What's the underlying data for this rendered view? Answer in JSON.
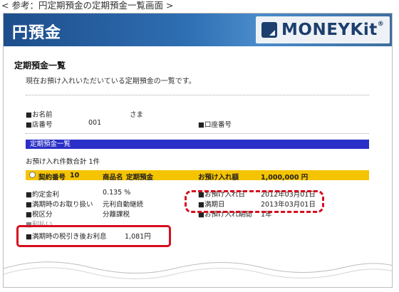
{
  "caption": "< 参考：円定期預金の定期預金一覧画面 >",
  "header": {
    "title": "円預金",
    "logo_text": "MONEYKit",
    "logo_tm": "®"
  },
  "page": {
    "title": "定期預金一覧",
    "description": "現在お預け入れいただいている定期預金の一覧です。"
  },
  "customer": {
    "name_label": "■お名前",
    "name_suffix": "さま",
    "branch_label": "■店番号",
    "branch_value": "001",
    "account_label": "■口座番号"
  },
  "section": {
    "title": "定期預金一覧",
    "count_label": "お預け入れ件数合計",
    "count_value": "1件"
  },
  "deposit_row": {
    "contract_label": "契約番号",
    "contract_value": "10",
    "product_label": "商品名",
    "product_value": "定期預金",
    "amount_label": "お預け入れ額",
    "amount_value": "1,000,000 円"
  },
  "details": {
    "rate_label": "■約定金利",
    "rate_value": "0.135 %",
    "maturity_handling_label": "■満期時のお取り扱い",
    "maturity_handling_value": "元利自動継続",
    "tax_label": "■税区分",
    "tax_value": "分離課税",
    "interest_label": "■利払い",
    "after_tax_label": "■満期時の税引き後お利息",
    "after_tax_value": "1,081円",
    "deposit_date_label": "■お預け入れ日",
    "deposit_date_value": "2012年03月01日",
    "maturity_date_label": "■満期日",
    "maturity_date_value": "2013年03月01日",
    "period_label": "■お預け入れ期間",
    "period_value": "1年"
  },
  "colors": {
    "header_blue": "#1d4e8c",
    "section_blue": "#2a2fc7",
    "row_yellow": "#f5c400",
    "highlight_red": "#d80d1f"
  }
}
